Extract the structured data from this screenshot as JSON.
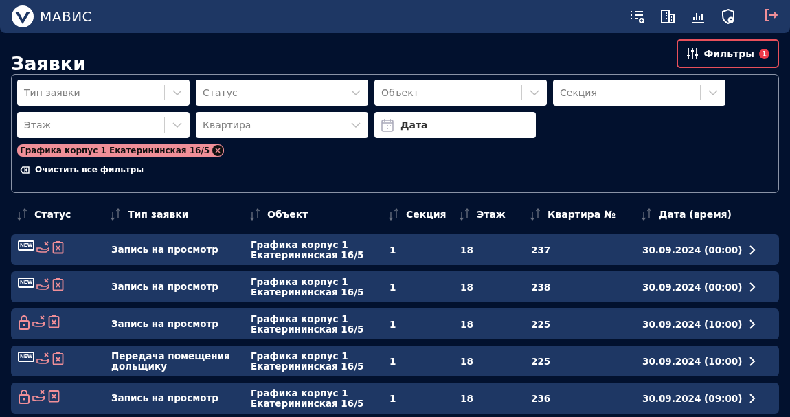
{
  "header": {
    "brand": "МАВИС"
  },
  "title": "Заявки",
  "filters_button": {
    "label": "Фильтры",
    "badge": "1"
  },
  "filters": [
    {
      "kind": "select",
      "placeholder": "Тип заявки"
    },
    {
      "kind": "select",
      "placeholder": "Статус"
    },
    {
      "kind": "select",
      "placeholder": "Объект"
    },
    {
      "kind": "select",
      "placeholder": "Секция"
    },
    {
      "kind": "select",
      "placeholder": "Этаж"
    },
    {
      "kind": "select",
      "placeholder": "Квартира"
    },
    {
      "kind": "date",
      "placeholder": "Дата"
    }
  ],
  "chips": [
    "Графика корпус 1 Екатерининская 16/5"
  ],
  "clear_filters": "Очистить все фильтры",
  "table": {
    "columns": [
      "Статус",
      "Тип заявки",
      "Объект",
      "Секция",
      "Этаж",
      "Квартира №",
      "Дата (время)"
    ],
    "rows": [
      {
        "kind": "new",
        "badge": "NEW",
        "type": "Запись на просмотр",
        "object": "Графика корпус 1 Екатерининская 16/5",
        "section": "1",
        "floor": "18",
        "apartment": "237",
        "date": "30.09.2024 (00:00)"
      },
      {
        "kind": "new",
        "badge": "NEW",
        "type": "Запись на просмотр",
        "object": "Графика корпус 1 Екатерининская 16/5",
        "section": "1",
        "floor": "18",
        "apartment": "238",
        "date": "30.09.2024 (00:00)"
      },
      {
        "kind": "locked",
        "type": "Запись на просмотр",
        "object": "Графика корпус 1 Екатерининская 16/5",
        "section": "1",
        "floor": "18",
        "apartment": "225",
        "date": "30.09.2024 (10:00)"
      },
      {
        "kind": "new",
        "badge": "NEW",
        "type": "Передача помещения дольщику",
        "object": "Графика корпус 1 Екатерининская 16/5",
        "section": "1",
        "floor": "18",
        "apartment": "225",
        "date": "30.09.2024 (10:00)"
      },
      {
        "kind": "locked",
        "type": "Запись на просмотр",
        "object": "Графика корпус 1 Екатерининская 16/5",
        "section": "1",
        "floor": "18",
        "apartment": "236",
        "date": "30.09.2024 (09:00)"
      }
    ]
  }
}
